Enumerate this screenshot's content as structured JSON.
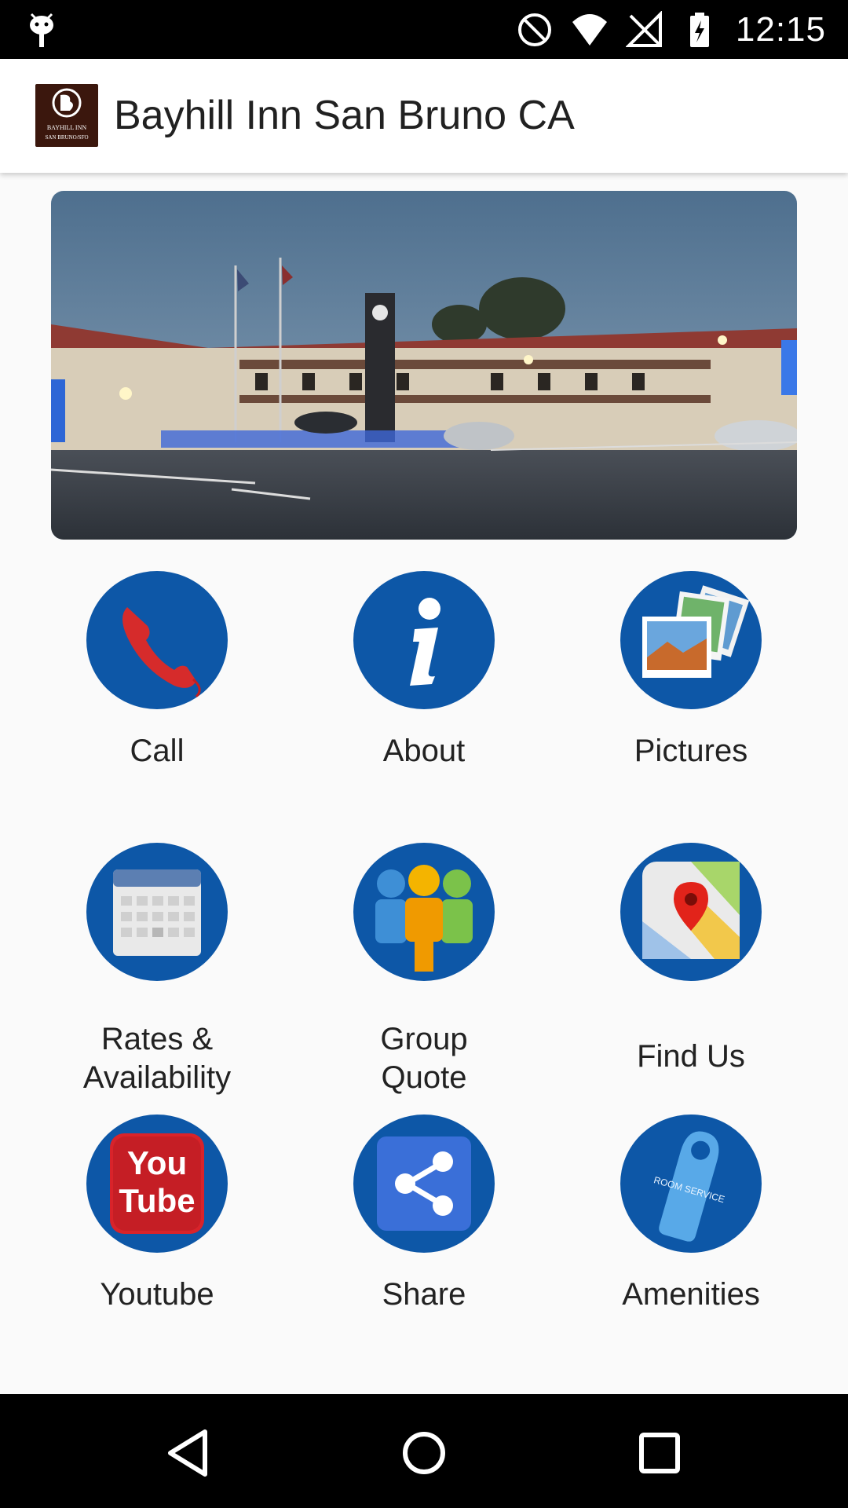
{
  "status_bar": {
    "time": "12:15",
    "icons": [
      "android-debug-icon",
      "do-not-disturb-icon",
      "wifi-icon",
      "no-signal-icon",
      "battery-charging-icon"
    ]
  },
  "app_bar": {
    "title": "Bayhill Inn San Bruno CA",
    "logo_icon": "bayhill-inn-logo-icon",
    "logo_text": "BAYHILL INN SAN BRUNO/SFO"
  },
  "hero": {
    "image": "hotel-exterior-photo"
  },
  "menu": {
    "items": [
      {
        "label": "Call",
        "icon": "phone-icon"
      },
      {
        "label": "About",
        "icon": "info-icon"
      },
      {
        "label": "Pictures",
        "icon": "photos-icon"
      },
      {
        "label": "Rates & Availability",
        "label_line1": "Rates &",
        "label_line2": "Availability",
        "icon": "calendar-icon"
      },
      {
        "label": "Group Quote",
        "label_line1": "Group",
        "label_line2": "Quote",
        "icon": "group-icon"
      },
      {
        "label": "Find Us",
        "icon": "map-pin-icon"
      },
      {
        "label": "Youtube",
        "icon": "youtube-icon"
      },
      {
        "label": "Share",
        "icon": "share-icon"
      },
      {
        "label": "Amenities",
        "icon": "room-service-tag-icon",
        "icon_text": "ROOM SERVICE"
      }
    ]
  },
  "nav_bar": {
    "buttons": [
      "back-icon",
      "home-icon",
      "recents-icon"
    ]
  },
  "colors": {
    "accent_blue": "#0d57a7",
    "status_bar": "#000000",
    "app_bar": "#ffffff",
    "background": "#fafafa"
  }
}
